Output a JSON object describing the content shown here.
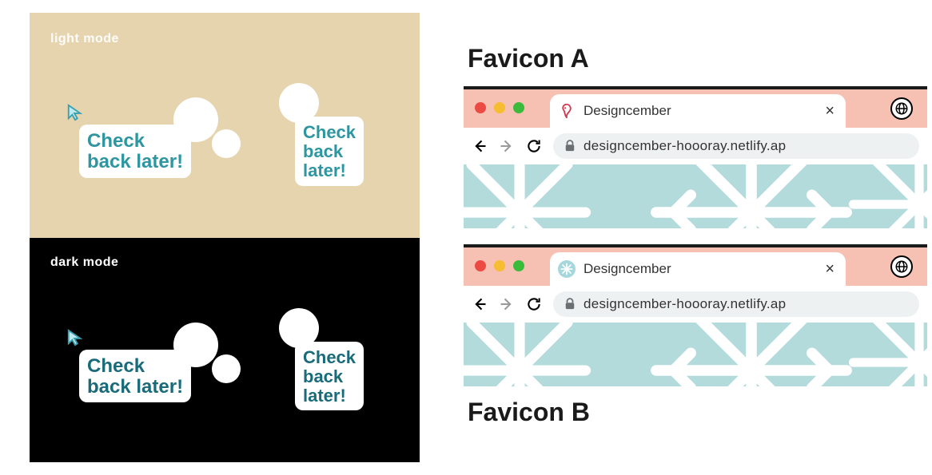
{
  "leftPane": {
    "lightLabel": "light mode",
    "darkLabel": "dark mode",
    "bubbleBigLine1": "Check",
    "bubbleBigLine2": "back later!",
    "bubbleSmallLine1": "Check",
    "bubbleSmallLine2": "back",
    "bubbleSmallLine3": "later!",
    "flakeColor": "#9fd4df",
    "cursorStroke": "#38a0b0",
    "cursorFill": "#bfe8ef"
  },
  "faviconA": {
    "heading": "Favicon A",
    "faviconColor": "#d23a52",
    "tabTitle": "Designcember",
    "urlText": "designcember-hoooray.netlify.ap",
    "tabStripColor": "#f6c1b3",
    "pageBg": "#b3dbdc",
    "pageFlakeColor": "#ffffff"
  },
  "faviconB": {
    "heading": "Favicon B",
    "faviconBg": "#a6d7dd",
    "faviconGlyphColor": "#ffffff",
    "tabTitle": "Designcember",
    "urlText": "designcember-hoooray.netlify.ap",
    "tabStripColor": "#f6c1b3",
    "pageBg": "#b3dbdc",
    "pageFlakeColor": "#ffffff"
  },
  "icons": {
    "closeGlyph": "×"
  }
}
